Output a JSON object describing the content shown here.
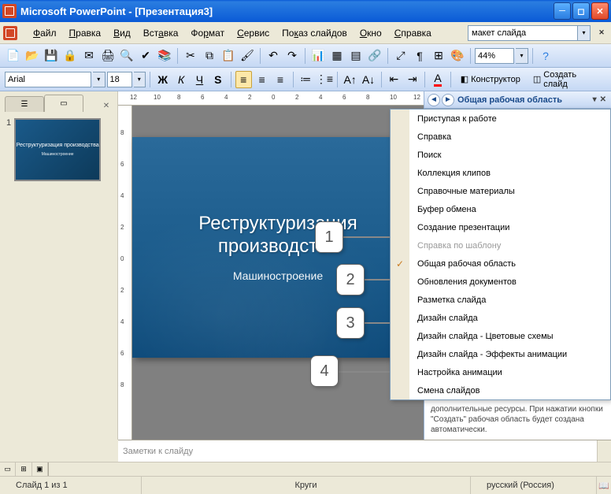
{
  "titlebar": {
    "app": "Microsoft PowerPoint",
    "doc": "[Презентация3]"
  },
  "menu": {
    "items": [
      "Файл",
      "Правка",
      "Вид",
      "Вставка",
      "Формат",
      "Сервис",
      "Показ слайдов",
      "Окно",
      "Справка"
    ],
    "underline_idx": [
      0,
      0,
      0,
      3,
      2,
      0,
      2,
      0,
      0
    ],
    "search_value": "макет слайда"
  },
  "toolbar": {
    "zoom": "44%"
  },
  "formatbar": {
    "font": "Arial",
    "size": "18",
    "designer": "Конструктор",
    "new_slide": "Создать слайд"
  },
  "ruler_h": [
    "12",
    "10",
    "8",
    "6",
    "4",
    "2",
    "0",
    "2",
    "4",
    "6",
    "8",
    "10",
    "12"
  ],
  "ruler_v": [
    "8",
    "6",
    "4",
    "2",
    "0",
    "2",
    "4",
    "6",
    "8"
  ],
  "thumb": {
    "num": "1",
    "title": "Реструктуризация производства",
    "sub": "Машиностроение"
  },
  "slide": {
    "title_l1": "Реструктуризация",
    "title_l2": "производства",
    "sub": "Машиностроение"
  },
  "callouts": [
    "1",
    "2",
    "3",
    "4"
  ],
  "taskpane": {
    "title": "Общая рабочая область",
    "menu": [
      {
        "label": "Приступая к работе",
        "checked": false,
        "disabled": false
      },
      {
        "label": "Справка",
        "checked": false,
        "disabled": false
      },
      {
        "label": "Поиск",
        "checked": false,
        "disabled": false
      },
      {
        "label": "Коллекция клипов",
        "checked": false,
        "disabled": false
      },
      {
        "label": "Справочные материалы",
        "checked": false,
        "disabled": false
      },
      {
        "label": "Буфер обмена",
        "checked": false,
        "disabled": false
      },
      {
        "label": "Создание презентации",
        "checked": false,
        "disabled": false
      },
      {
        "label": "Справка по шаблону",
        "checked": false,
        "disabled": true
      },
      {
        "label": "Общая рабочая область",
        "checked": true,
        "disabled": false
      },
      {
        "label": "Обновления документов",
        "checked": false,
        "disabled": false
      },
      {
        "label": "Разметка слайда",
        "checked": false,
        "disabled": false
      },
      {
        "label": "Дизайн слайда",
        "checked": false,
        "disabled": false
      },
      {
        "label": "Дизайн слайда - Цветовые схемы",
        "checked": false,
        "disabled": false
      },
      {
        "label": "Дизайн слайда - Эффекты анимации",
        "checked": false,
        "disabled": false
      },
      {
        "label": "Настройка анимации",
        "checked": false,
        "disabled": false
      },
      {
        "label": "Смена слайдов",
        "checked": false,
        "disabled": false
      }
    ],
    "footer_text": "дополнительные ресурсы. При нажатии кнопки \"Создать\" рабочая область будет создана автоматически."
  },
  "notes": {
    "placeholder": "Заметки к слайду"
  },
  "status": {
    "slide": "Слайд 1 из 1",
    "template": "Круги",
    "lang": "русский (Россия)"
  }
}
